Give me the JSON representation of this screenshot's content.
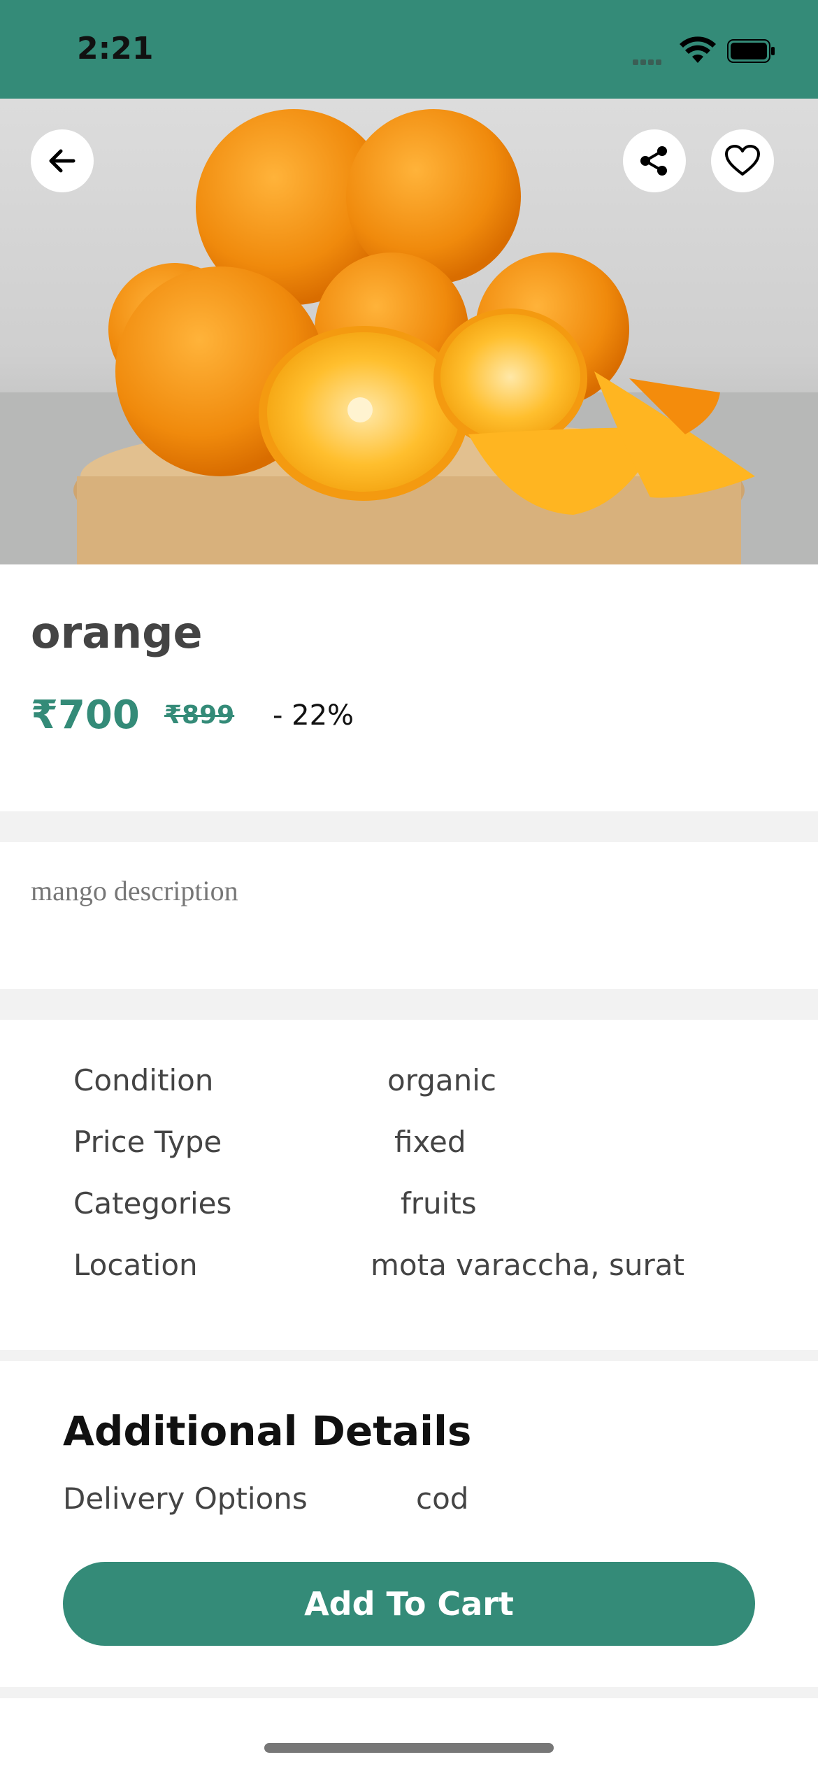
{
  "status_bar": {
    "time": "2:21"
  },
  "product": {
    "title": "orange",
    "price": "₹700",
    "old_price": "₹899",
    "discount": "- 22%",
    "description": "mango description"
  },
  "specs": [
    {
      "label": "Condition",
      "value": "organic"
    },
    {
      "label": "Price Type",
      "value": "fixed"
    },
    {
      "label": "Categories",
      "value": "fruits"
    },
    {
      "label": "Location",
      "value": "mota varaccha, surat"
    }
  ],
  "additional": {
    "title": "Additional Details",
    "delivery_label": "Delivery Options",
    "delivery_value": "cod"
  },
  "actions": {
    "add_to_cart": "Add To Cart"
  },
  "icons": {
    "back": "arrow-left-icon",
    "share": "share-icon",
    "favorite": "heart-icon"
  },
  "colors": {
    "accent": "#348b78",
    "status_bar": "#348b78"
  }
}
